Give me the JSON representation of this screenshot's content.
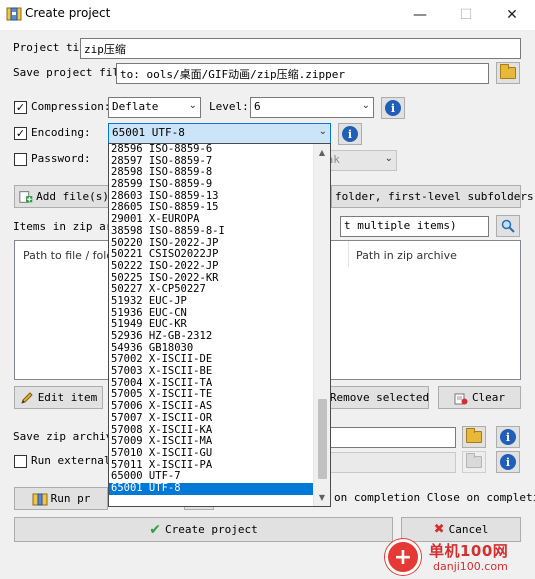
{
  "window": {
    "title": "Create project",
    "minimize_glyph": "—",
    "maximize_glyph": "☐",
    "close_glyph": "✕"
  },
  "project_title": {
    "label": "Project tit",
    "value": "zip压缩"
  },
  "save_project_file": {
    "label": "Save project file",
    "value": "to: ools/桌面/GIF动画/zip压缩.zipper"
  },
  "compression": {
    "label": "Compression:",
    "checked": true,
    "value": "Deflate",
    "level_label": "Level:",
    "level_value": "6"
  },
  "encoding": {
    "label": "Encoding:",
    "checked": true,
    "value": "65001 UTF-8"
  },
  "password": {
    "label": "Password:",
    "checked": false,
    "strength_value": "eak"
  },
  "add_files": {
    "label": "Add file(s)",
    "scan_label": "folder, first-level subfolders"
  },
  "items_in_zip": {
    "label": "Items in zip arc",
    "filter_placeholder": "t multiple items)"
  },
  "table": {
    "columns": [
      "Path to file / folder",
      "Path in zip archive"
    ]
  },
  "buttons": {
    "edit_item": "Edit item",
    "remove_selected": "Remove selected",
    "clear": "Clear",
    "run": "Run pr",
    "create_project": "Create project",
    "cancel": "Cancel"
  },
  "save_zip_archive": {
    "label": "Save zip archive"
  },
  "run_external": {
    "label": "Run external",
    "checked": false
  },
  "completion": {
    "text": "on completion Close on completion"
  },
  "encoding_dropdown": {
    "items": [
      "28596 ISO-8859-6",
      "28597 ISO-8859-7",
      "28598 ISO-8859-8",
      "28599 ISO-8859-9",
      "28603 ISO-8859-13",
      "28605 ISO-8859-15",
      "29001 X-EUROPA",
      "38598 ISO-8859-8-I",
      "50220 ISO-2022-JP",
      "50221 CSISO2022JP",
      "50222 ISO-2022-JP",
      "50225 ISO-2022-KR",
      "50227 X-CP50227",
      "51932 EUC-JP",
      "51936 EUC-CN",
      "51949 EUC-KR",
      "52936 HZ-GB-2312",
      "54936 GB18030",
      "57002 X-ISCII-DE",
      "57003 X-ISCII-BE",
      "57004 X-ISCII-TA",
      "57005 X-ISCII-TE",
      "57006 X-ISCII-AS",
      "57007 X-ISCII-OR",
      "57008 X-ISCII-KA",
      "57009 X-ISCII-MA",
      "57010 X-ISCII-GU",
      "57011 X-ISCII-PA",
      "65000 UTF-7",
      "65001 UTF-8"
    ],
    "selected_index": 29,
    "scroll_position": 0.96
  },
  "watermark": {
    "brand": "单机100网",
    "url": "danji100.com",
    "logo_glyph": "+"
  },
  "colors": {
    "accent": "#0078d7",
    "info_icon": "#1f5fb8",
    "folder_icon": "#e8b83a",
    "cancel_icon": "#d32f2f",
    "create_icon": "#2e9e3e"
  }
}
